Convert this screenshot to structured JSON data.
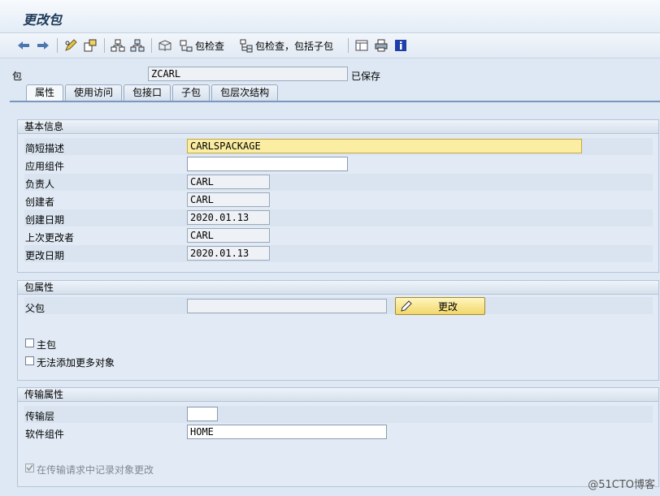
{
  "window": {
    "title": "更改包"
  },
  "toolbar": {
    "check_label": "包检查",
    "check_sub_label": "包检查，包括子包"
  },
  "package": {
    "label": "包",
    "value": "ZCARL",
    "status": "已保存"
  },
  "tabs": [
    {
      "label": "属性",
      "active": true
    },
    {
      "label": "使用访问"
    },
    {
      "label": "包接口"
    },
    {
      "label": "子包"
    },
    {
      "label": "包层次结构"
    }
  ],
  "basic": {
    "title": "基本信息",
    "fields": [
      {
        "label": "简短描述",
        "value": "CARLSPACKAGE"
      },
      {
        "label": "应用组件",
        "value": ""
      },
      {
        "label": "负责人",
        "value": "CARL"
      },
      {
        "label": "创建者",
        "value": "CARL"
      },
      {
        "label": "创建日期",
        "value": "2020.01.13"
      },
      {
        "label": "上次更改者",
        "value": "CARL"
      },
      {
        "label": "更改日期",
        "value": "2020.01.13"
      }
    ]
  },
  "pkgattr": {
    "title": "包属性",
    "parent_label": "父包",
    "parent_value": "",
    "change_button": "更改",
    "main_pkg_label": "主包",
    "no_more_objects_label": "无法添加更多对象"
  },
  "transport": {
    "title": "传输属性",
    "layer_label": "传输层",
    "layer_value": "",
    "component_label": "软件组件",
    "component_value": "HOME",
    "record_label": "在传输请求中记录对象更改"
  },
  "watermark": "@51CTO博客"
}
